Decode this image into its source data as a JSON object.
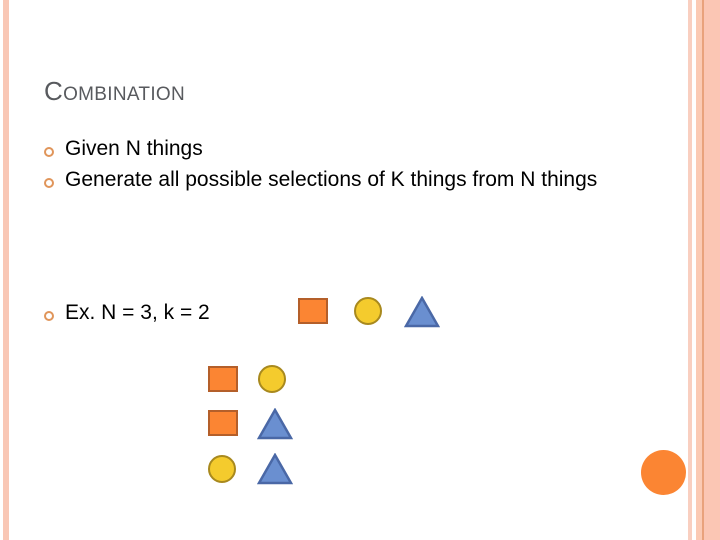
{
  "slide": {
    "title_cap": "C",
    "title_rest": "OMBINATION",
    "bullets": [
      {
        "text": "Given N things"
      },
      {
        "text": "Generate all possible selections of K things from N things"
      },
      {
        "text": "Ex. N = 3, k = 2"
      }
    ],
    "example_items": [
      "orange-square",
      "yellow-circle",
      "blue-triangle"
    ],
    "combinations": [
      [
        "orange-square",
        "yellow-circle"
      ],
      [
        "orange-square",
        "blue-triangle"
      ],
      [
        "yellow-circle",
        "blue-triangle"
      ]
    ]
  },
  "colors": {
    "accent": "#fb8533",
    "square_fill": "#fb8533",
    "circle_fill": "#f4cb2d",
    "triangle_fill": "#6a8fd0",
    "bullet": "#e0955a",
    "title": "#585a5e"
  }
}
